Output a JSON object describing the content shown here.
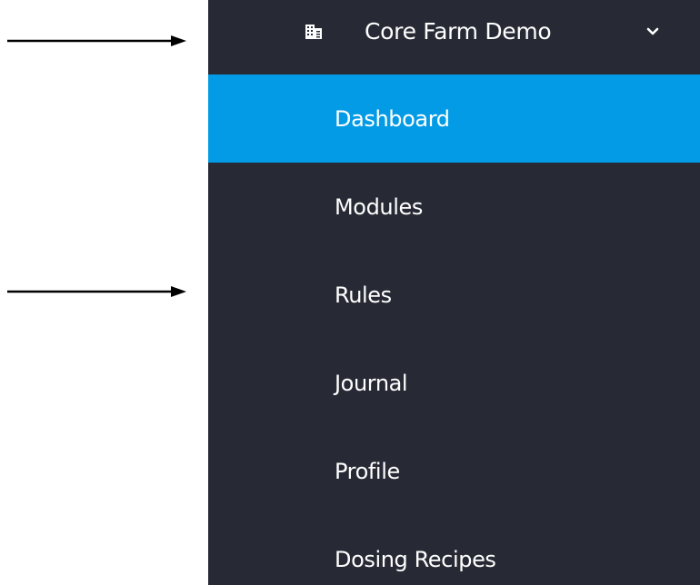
{
  "sidebar": {
    "farm_switcher": {
      "name": "Core Farm Demo",
      "icon": "building-icon",
      "dropdown_icon": "chevron-down-icon"
    },
    "items": [
      {
        "label": "Dashboard",
        "active": true
      },
      {
        "label": "Modules",
        "active": false
      },
      {
        "label": "Rules",
        "active": false
      },
      {
        "label": "Journal",
        "active": false
      },
      {
        "label": "Profile",
        "active": false
      },
      {
        "label": "Dosing Recipes",
        "active": false
      }
    ]
  },
  "annotations": {
    "arrow_color": "#000000",
    "arrow_icon": "right-arrow-icon"
  },
  "colors": {
    "sidebar_background": "#272a35",
    "active_item_background": "#039be5",
    "text": "#ffffff"
  }
}
